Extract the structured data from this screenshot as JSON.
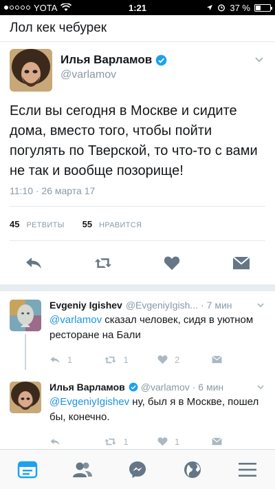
{
  "status_bar": {
    "carrier": "YOTA",
    "time": "1:21",
    "battery": "37 %",
    "battery_level": 0.37
  },
  "caption": "Лол кек чебурек",
  "main_tweet": {
    "name": "Илья Варламов",
    "handle": "@varlamov",
    "text": "Если вы сегодня в Москве и сидите дома, вместо того, чтобы пойти погулять по Тверской, то что-то с вами не так и вообще позорище!",
    "date": "11:10 · 26 марта 17",
    "retweets_count": "45",
    "retweets_label": "РЕТВИТЫ",
    "likes_count": "55",
    "likes_label": "НРАВИТСЯ"
  },
  "replies": [
    {
      "name": "Evgeniy Igishev",
      "handle": "@EvgeniyIgish...",
      "time": "· 7 мин",
      "mention": "@varlamov",
      "text": " сказал человек, сидя в уютном ресторане на Бали",
      "reply_count": "1",
      "retweet_count": "1",
      "like_count": "2"
    },
    {
      "name": "Илья Варламов",
      "handle": "@varlamov",
      "time": "· 6 мин",
      "mention": "@EvgeniyIgishev",
      "text": " ну, был я в Москве, пошел бы, конечно.",
      "retweet_count": "1",
      "like_count": "1"
    }
  ],
  "tabs": [
    "home-icon",
    "people-icon",
    "messenger-icon",
    "globe-icon",
    "menu-icon"
  ],
  "colors": {
    "accent": "#1da1f2",
    "mention": "#1b95e0",
    "muted": "#8899a6",
    "tab_active": "#1da1f2"
  }
}
